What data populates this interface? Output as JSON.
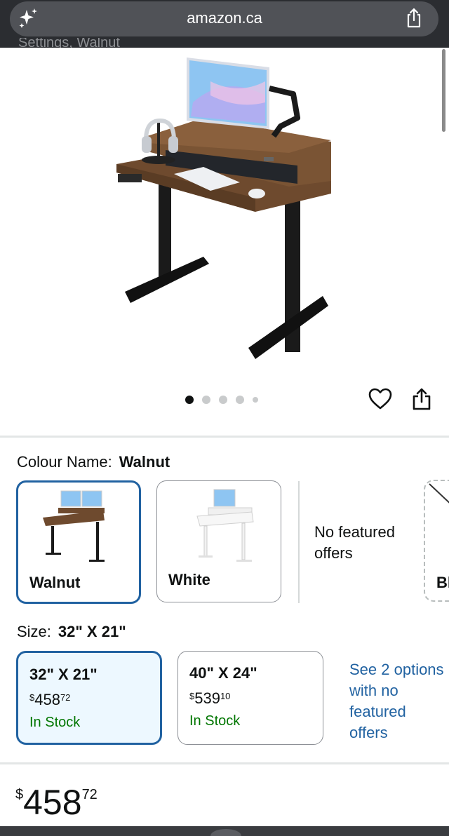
{
  "browser": {
    "url": "amazon.ca",
    "cut_off_text": "Settings, Walnut"
  },
  "carousel": {
    "dot_count": 5,
    "active_index": 0
  },
  "colour": {
    "label": "Colour Name:",
    "selected": "Walnut",
    "options": [
      {
        "name": "Walnut",
        "selected": true
      },
      {
        "name": "White",
        "selected": false
      }
    ],
    "no_featured_offers": "No featured offers",
    "partial_option": "Bl"
  },
  "size": {
    "label": "Size:",
    "selected": "32\" X 21\"",
    "options": [
      {
        "name": "32\" X 21\"",
        "price_symbol": "$",
        "price_whole": "458",
        "price_cents": "72",
        "stock": "In Stock",
        "selected": true
      },
      {
        "name": "40\" X 24\"",
        "price_symbol": "$",
        "price_whole": "539",
        "price_cents": "10",
        "stock": "In Stock",
        "selected": false
      }
    ],
    "see_options": "See 2 options with no featured offers"
  },
  "price": {
    "symbol": "$",
    "whole": "458",
    "cents": "72"
  },
  "colors": {
    "link_blue": "#2162a1",
    "stock_green": "#007600",
    "selected_bg": "#edf8ff",
    "walnut": "#6e4a2e"
  },
  "icons": [
    "sparkle-icon",
    "share-icon",
    "heart-icon"
  ]
}
